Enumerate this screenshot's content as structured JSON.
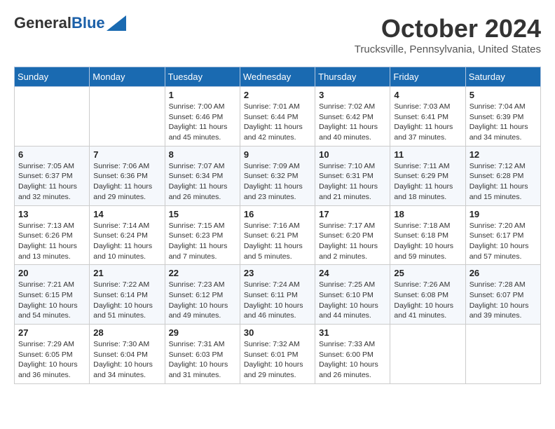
{
  "header": {
    "logo_general": "General",
    "logo_blue": "Blue",
    "month_title": "October 2024",
    "location": "Trucksville, Pennsylvania, United States"
  },
  "weekdays": [
    "Sunday",
    "Monday",
    "Tuesday",
    "Wednesday",
    "Thursday",
    "Friday",
    "Saturday"
  ],
  "weeks": [
    [
      {
        "day": "",
        "sunrise": "",
        "sunset": "",
        "daylight": ""
      },
      {
        "day": "",
        "sunrise": "",
        "sunset": "",
        "daylight": ""
      },
      {
        "day": "1",
        "sunrise": "Sunrise: 7:00 AM",
        "sunset": "Sunset: 6:46 PM",
        "daylight": "Daylight: 11 hours and 45 minutes."
      },
      {
        "day": "2",
        "sunrise": "Sunrise: 7:01 AM",
        "sunset": "Sunset: 6:44 PM",
        "daylight": "Daylight: 11 hours and 42 minutes."
      },
      {
        "day": "3",
        "sunrise": "Sunrise: 7:02 AM",
        "sunset": "Sunset: 6:42 PM",
        "daylight": "Daylight: 11 hours and 40 minutes."
      },
      {
        "day": "4",
        "sunrise": "Sunrise: 7:03 AM",
        "sunset": "Sunset: 6:41 PM",
        "daylight": "Daylight: 11 hours and 37 minutes."
      },
      {
        "day": "5",
        "sunrise": "Sunrise: 7:04 AM",
        "sunset": "Sunset: 6:39 PM",
        "daylight": "Daylight: 11 hours and 34 minutes."
      }
    ],
    [
      {
        "day": "6",
        "sunrise": "Sunrise: 7:05 AM",
        "sunset": "Sunset: 6:37 PM",
        "daylight": "Daylight: 11 hours and 32 minutes."
      },
      {
        "day": "7",
        "sunrise": "Sunrise: 7:06 AM",
        "sunset": "Sunset: 6:36 PM",
        "daylight": "Daylight: 11 hours and 29 minutes."
      },
      {
        "day": "8",
        "sunrise": "Sunrise: 7:07 AM",
        "sunset": "Sunset: 6:34 PM",
        "daylight": "Daylight: 11 hours and 26 minutes."
      },
      {
        "day": "9",
        "sunrise": "Sunrise: 7:09 AM",
        "sunset": "Sunset: 6:32 PM",
        "daylight": "Daylight: 11 hours and 23 minutes."
      },
      {
        "day": "10",
        "sunrise": "Sunrise: 7:10 AM",
        "sunset": "Sunset: 6:31 PM",
        "daylight": "Daylight: 11 hours and 21 minutes."
      },
      {
        "day": "11",
        "sunrise": "Sunrise: 7:11 AM",
        "sunset": "Sunset: 6:29 PM",
        "daylight": "Daylight: 11 hours and 18 minutes."
      },
      {
        "day": "12",
        "sunrise": "Sunrise: 7:12 AM",
        "sunset": "Sunset: 6:28 PM",
        "daylight": "Daylight: 11 hours and 15 minutes."
      }
    ],
    [
      {
        "day": "13",
        "sunrise": "Sunrise: 7:13 AM",
        "sunset": "Sunset: 6:26 PM",
        "daylight": "Daylight: 11 hours and 13 minutes."
      },
      {
        "day": "14",
        "sunrise": "Sunrise: 7:14 AM",
        "sunset": "Sunset: 6:24 PM",
        "daylight": "Daylight: 11 hours and 10 minutes."
      },
      {
        "day": "15",
        "sunrise": "Sunrise: 7:15 AM",
        "sunset": "Sunset: 6:23 PM",
        "daylight": "Daylight: 11 hours and 7 minutes."
      },
      {
        "day": "16",
        "sunrise": "Sunrise: 7:16 AM",
        "sunset": "Sunset: 6:21 PM",
        "daylight": "Daylight: 11 hours and 5 minutes."
      },
      {
        "day": "17",
        "sunrise": "Sunrise: 7:17 AM",
        "sunset": "Sunset: 6:20 PM",
        "daylight": "Daylight: 11 hours and 2 minutes."
      },
      {
        "day": "18",
        "sunrise": "Sunrise: 7:18 AM",
        "sunset": "Sunset: 6:18 PM",
        "daylight": "Daylight: 10 hours and 59 minutes."
      },
      {
        "day": "19",
        "sunrise": "Sunrise: 7:20 AM",
        "sunset": "Sunset: 6:17 PM",
        "daylight": "Daylight: 10 hours and 57 minutes."
      }
    ],
    [
      {
        "day": "20",
        "sunrise": "Sunrise: 7:21 AM",
        "sunset": "Sunset: 6:15 PM",
        "daylight": "Daylight: 10 hours and 54 minutes."
      },
      {
        "day": "21",
        "sunrise": "Sunrise: 7:22 AM",
        "sunset": "Sunset: 6:14 PM",
        "daylight": "Daylight: 10 hours and 51 minutes."
      },
      {
        "day": "22",
        "sunrise": "Sunrise: 7:23 AM",
        "sunset": "Sunset: 6:12 PM",
        "daylight": "Daylight: 10 hours and 49 minutes."
      },
      {
        "day": "23",
        "sunrise": "Sunrise: 7:24 AM",
        "sunset": "Sunset: 6:11 PM",
        "daylight": "Daylight: 10 hours and 46 minutes."
      },
      {
        "day": "24",
        "sunrise": "Sunrise: 7:25 AM",
        "sunset": "Sunset: 6:10 PM",
        "daylight": "Daylight: 10 hours and 44 minutes."
      },
      {
        "day": "25",
        "sunrise": "Sunrise: 7:26 AM",
        "sunset": "Sunset: 6:08 PM",
        "daylight": "Daylight: 10 hours and 41 minutes."
      },
      {
        "day": "26",
        "sunrise": "Sunrise: 7:28 AM",
        "sunset": "Sunset: 6:07 PM",
        "daylight": "Daylight: 10 hours and 39 minutes."
      }
    ],
    [
      {
        "day": "27",
        "sunrise": "Sunrise: 7:29 AM",
        "sunset": "Sunset: 6:05 PM",
        "daylight": "Daylight: 10 hours and 36 minutes."
      },
      {
        "day": "28",
        "sunrise": "Sunrise: 7:30 AM",
        "sunset": "Sunset: 6:04 PM",
        "daylight": "Daylight: 10 hours and 34 minutes."
      },
      {
        "day": "29",
        "sunrise": "Sunrise: 7:31 AM",
        "sunset": "Sunset: 6:03 PM",
        "daylight": "Daylight: 10 hours and 31 minutes."
      },
      {
        "day": "30",
        "sunrise": "Sunrise: 7:32 AM",
        "sunset": "Sunset: 6:01 PM",
        "daylight": "Daylight: 10 hours and 29 minutes."
      },
      {
        "day": "31",
        "sunrise": "Sunrise: 7:33 AM",
        "sunset": "Sunset: 6:00 PM",
        "daylight": "Daylight: 10 hours and 26 minutes."
      },
      {
        "day": "",
        "sunrise": "",
        "sunset": "",
        "daylight": ""
      },
      {
        "day": "",
        "sunrise": "",
        "sunset": "",
        "daylight": ""
      }
    ]
  ]
}
